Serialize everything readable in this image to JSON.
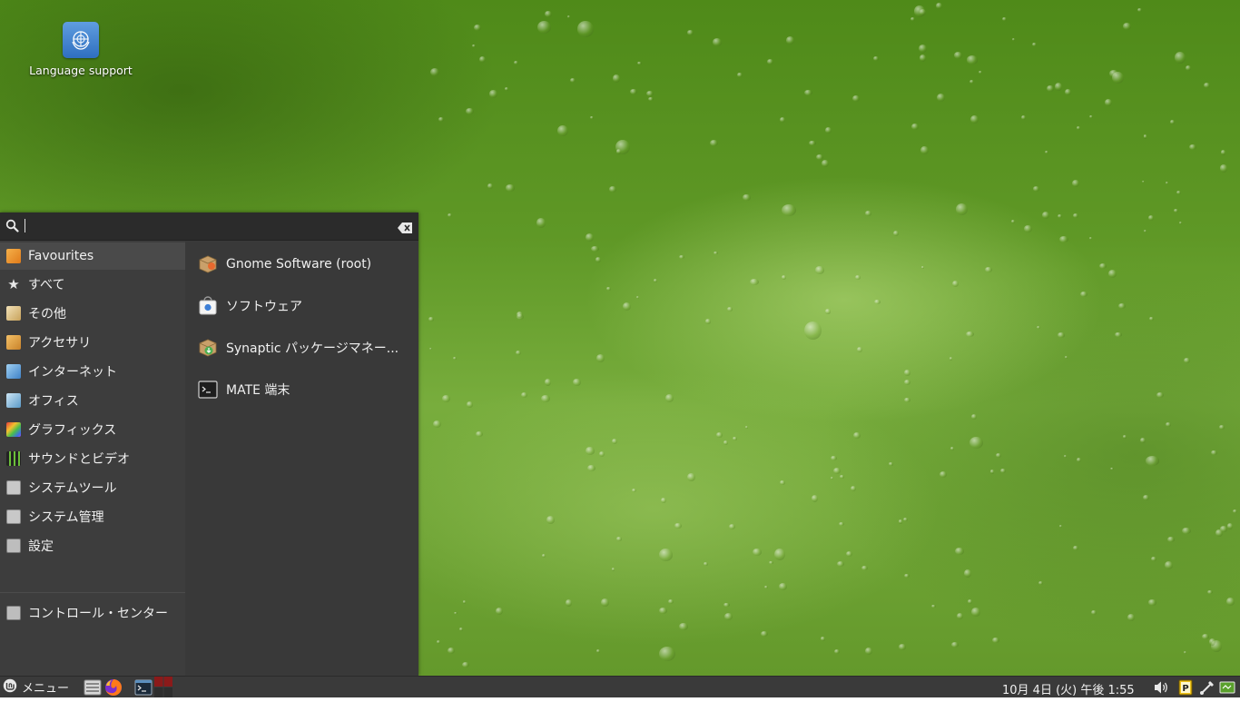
{
  "desktop": {
    "icons": [
      {
        "label": "Language support",
        "icon": "un-flag-icon"
      }
    ]
  },
  "menu": {
    "search": {
      "value": "",
      "placeholder": ""
    },
    "categories": [
      {
        "label": "Favourites",
        "icon": "favourites-icon",
        "selected": true
      },
      {
        "label": "すべて",
        "icon": "star-icon"
      },
      {
        "label": "その他",
        "icon": "other-icon"
      },
      {
        "label": "アクセサリ",
        "icon": "accessories-icon"
      },
      {
        "label": "インターネット",
        "icon": "internet-icon"
      },
      {
        "label": "オフィス",
        "icon": "office-icon"
      },
      {
        "label": "グラフィックス",
        "icon": "graphics-icon"
      },
      {
        "label": "サウンドとビデオ",
        "icon": "sound-video-icon"
      },
      {
        "label": "システムツール",
        "icon": "system-tools-icon"
      },
      {
        "label": "システム管理",
        "icon": "system-admin-icon"
      },
      {
        "label": "設定",
        "icon": "settings-icon"
      }
    ],
    "control_center": {
      "label": "コントロール・センター",
      "icon": "control-center-icon"
    },
    "applications": [
      {
        "label": "Gnome Software (root)",
        "icon": "gnome-software-icon"
      },
      {
        "label": "ソフトウェア",
        "icon": "software-icon"
      },
      {
        "label": "Synaptic パッケージマネー...",
        "icon": "synaptic-icon"
      },
      {
        "label": "MATE 端末",
        "icon": "terminal-icon"
      }
    ],
    "session_buttons": [
      "logout-icon",
      "lock-icon",
      "power-icon"
    ]
  },
  "taskbar": {
    "menu_label": "メニュー",
    "launchers": [
      "file-manager-icon",
      "firefox-icon",
      "terminal-icon",
      "workspace-switcher-icon"
    ],
    "clock": "10月 4日 (火) 午後  1:55",
    "tray": [
      "volume-icon",
      "parcellite-icon",
      "network-tool-icon",
      "battery-icon"
    ]
  },
  "colors": {
    "menu_bg": "#393939",
    "category_bg": "#3d3d3d",
    "taskbar_bg": "#3a3a3a",
    "desktop_green": "#5f9826"
  }
}
